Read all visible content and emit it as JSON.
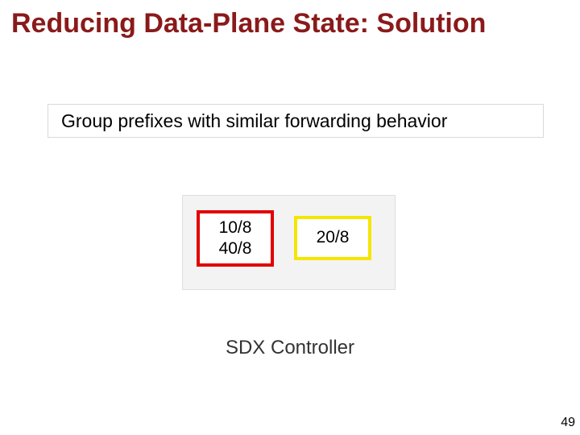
{
  "title": "Reducing Data-Plane State: Solution",
  "subtitle": "Group prefixes with similar forwarding behavior",
  "groups": {
    "red": {
      "line1": "10/8",
      "line2": "40/8"
    },
    "yellow": {
      "line1": "20/8"
    }
  },
  "controller_label": "SDX Controller",
  "page_number": "49",
  "colors": {
    "title": "#8a1a1a",
    "red_border": "#e20000",
    "yellow_border": "#f4e600",
    "group_bg": "#f3f3f3"
  }
}
